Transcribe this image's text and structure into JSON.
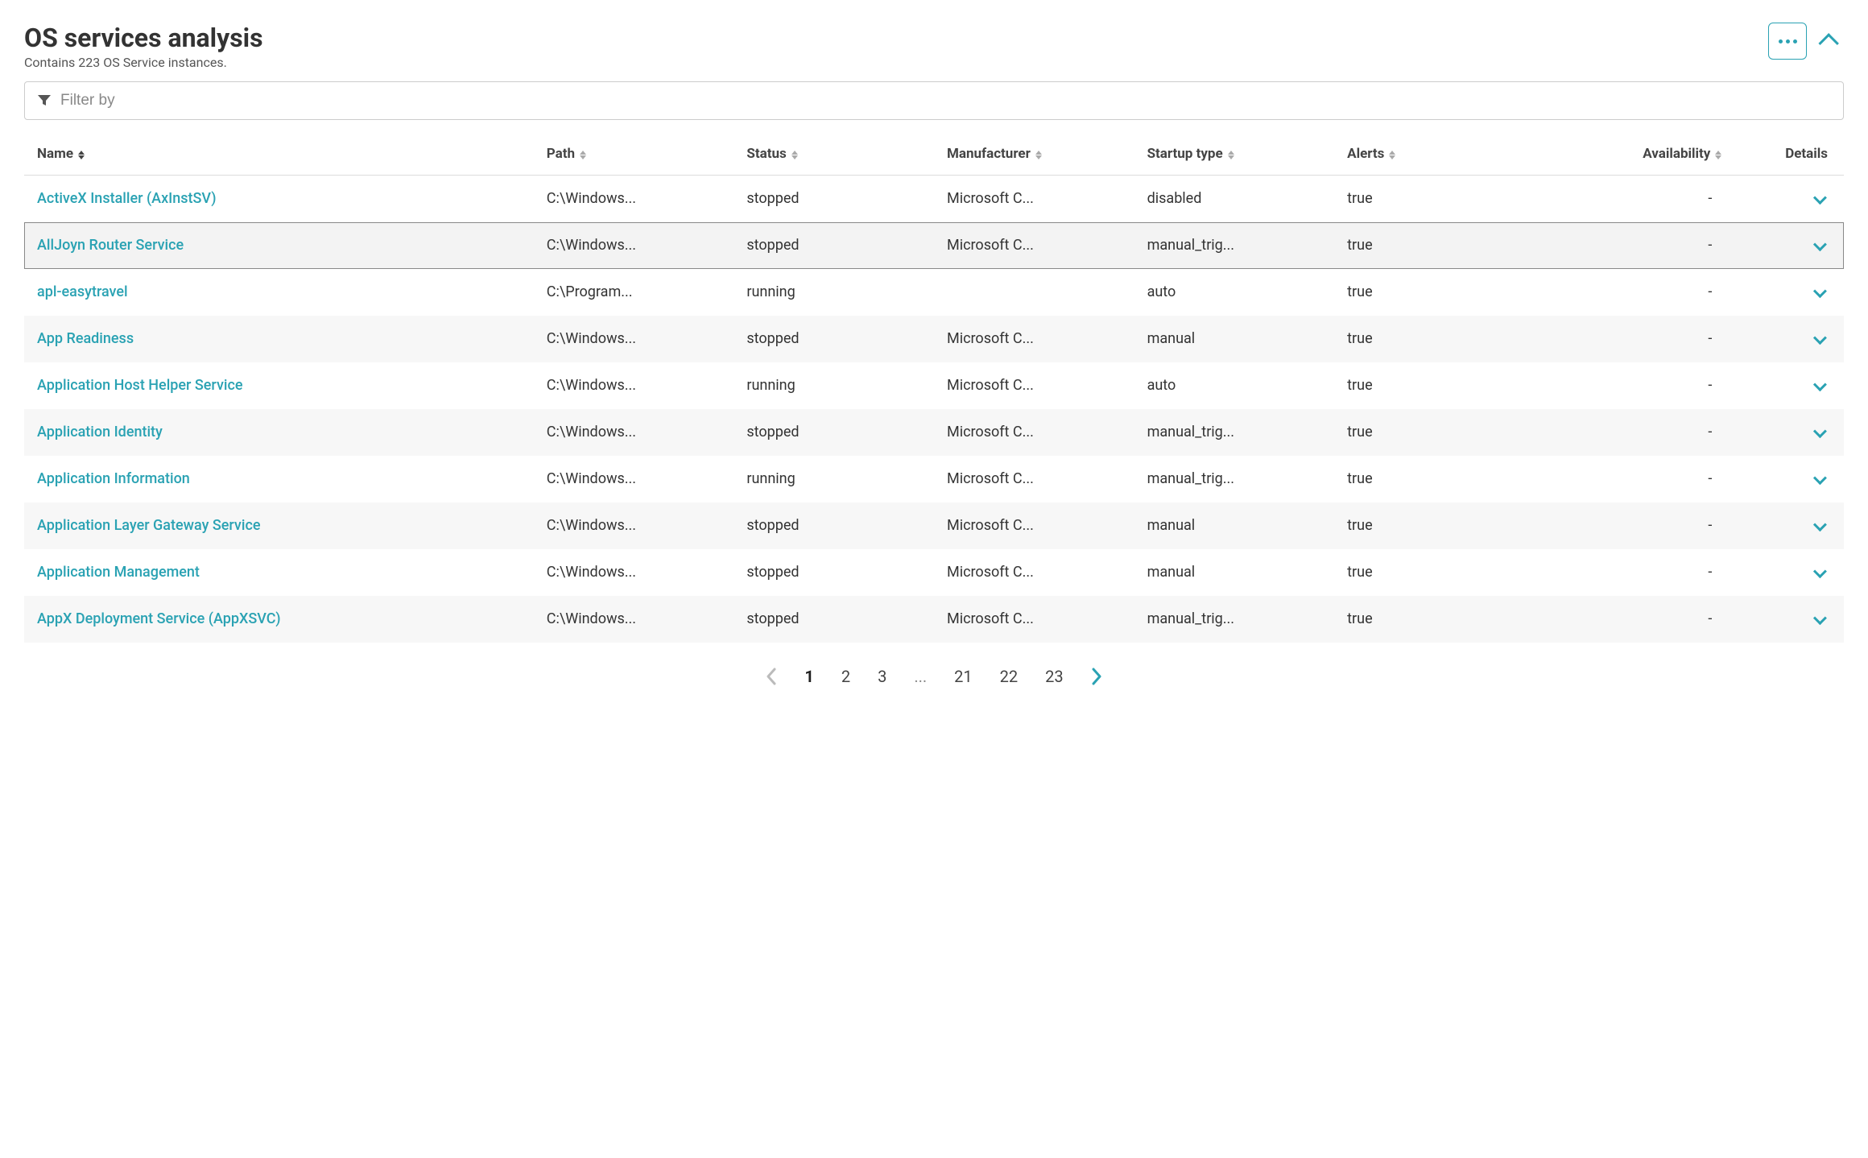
{
  "header": {
    "title": "OS services analysis",
    "subtitle_prefix": "Contains ",
    "instance_count": 223,
    "subtitle_suffix": " OS Service instances."
  },
  "filter": {
    "placeholder": "Filter by"
  },
  "columns": {
    "name": "Name",
    "path": "Path",
    "status": "Status",
    "manufacturer": "Manufacturer",
    "startup": "Startup type",
    "alerts": "Alerts",
    "availability": "Availability",
    "details": "Details"
  },
  "rows": [
    {
      "name": "ActiveX Installer (AxInstSV)",
      "path": "C:\\Windows...",
      "status": "stopped",
      "manufacturer": "Microsoft C...",
      "startup": "disabled",
      "alerts": "true",
      "availability": "-"
    },
    {
      "name": "AllJoyn Router Service",
      "path": "C:\\Windows...",
      "status": "stopped",
      "manufacturer": "Microsoft C...",
      "startup": "manual_trig...",
      "alerts": "true",
      "availability": "-"
    },
    {
      "name": "apl-easytravel",
      "path": "C:\\Program...",
      "status": "running",
      "manufacturer": "",
      "startup": "auto",
      "alerts": "true",
      "availability": "-"
    },
    {
      "name": "App Readiness",
      "path": "C:\\Windows...",
      "status": "stopped",
      "manufacturer": "Microsoft C...",
      "startup": "manual",
      "alerts": "true",
      "availability": "-"
    },
    {
      "name": "Application Host Helper Service",
      "path": "C:\\Windows...",
      "status": "running",
      "manufacturer": "Microsoft C...",
      "startup": "auto",
      "alerts": "true",
      "availability": "-"
    },
    {
      "name": "Application Identity",
      "path": "C:\\Windows...",
      "status": "stopped",
      "manufacturer": "Microsoft C...",
      "startup": "manual_trig...",
      "alerts": "true",
      "availability": "-"
    },
    {
      "name": "Application Information",
      "path": "C:\\Windows...",
      "status": "running",
      "manufacturer": "Microsoft C...",
      "startup": "manual_trig...",
      "alerts": "true",
      "availability": "-"
    },
    {
      "name": "Application Layer Gateway Service",
      "path": "C:\\Windows...",
      "status": "stopped",
      "manufacturer": "Microsoft C...",
      "startup": "manual",
      "alerts": "true",
      "availability": "-"
    },
    {
      "name": "Application Management",
      "path": "C:\\Windows...",
      "status": "stopped",
      "manufacturer": "Microsoft C...",
      "startup": "manual",
      "alerts": "true",
      "availability": "-"
    },
    {
      "name": "AppX Deployment Service (AppXSVC)",
      "path": "C:\\Windows...",
      "status": "stopped",
      "manufacturer": "Microsoft C...",
      "startup": "manual_trig...",
      "alerts": "true",
      "availability": "-"
    }
  ],
  "hovered_row_index": 1,
  "pagination": {
    "current": 1,
    "last_pages": [
      21,
      22,
      23
    ],
    "first_pages": [
      1,
      2,
      3
    ]
  }
}
